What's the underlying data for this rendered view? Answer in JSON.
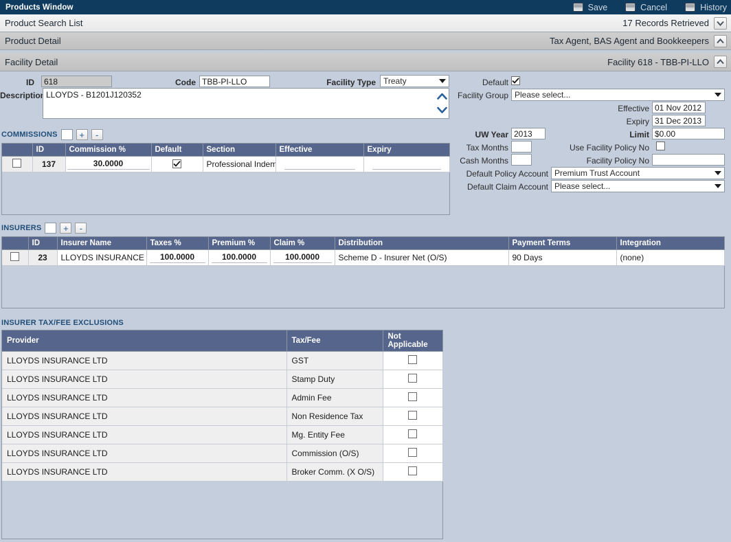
{
  "window": {
    "title": "Products Window"
  },
  "toolbar": {
    "buttons": [
      {
        "label": "Save",
        "icon": "save-icon"
      },
      {
        "label": "Cancel",
        "icon": "cancel-icon"
      },
      {
        "label": "History",
        "icon": "history-icon"
      }
    ]
  },
  "sections": [
    {
      "title": "Product Search List",
      "status": "17 Records Retrieved",
      "chevron": "chevron-down-icon"
    },
    {
      "title": "Product Detail",
      "status": "Tax Agent, BAS Agent and Bookkeepers",
      "chevron": "chevron-up-icon"
    },
    {
      "title": "Facility Detail",
      "status": "Facility 618 - TBB-PI-LLO",
      "chevron": "chevron-up-icon"
    }
  ],
  "facility": {
    "id_label": "ID",
    "id_value": "618",
    "code_label": "Code",
    "code_value": "TBB-PI-LLO",
    "facility_type_label": "Facility Type",
    "facility_type_value": "Treaty",
    "description_label": "Description",
    "description_value": "LLOYDS - B1201J120352",
    "default_label": "Default",
    "default_checked": true,
    "facility_group_label": "Facility Group",
    "facility_group_value": "Please select...",
    "effective_label": "Effective",
    "effective_value": "01 Nov 2012",
    "expiry_label": "Expiry",
    "expiry_value": "31 Dec 2013",
    "uw_year_label": "UW Year",
    "uw_year_value": "2013",
    "limit_label": "Limit",
    "limit_value": "$0.00",
    "tax_months_label": "Tax Months",
    "tax_months_value": "",
    "use_facility_policy_no_label": "Use Facility Policy No",
    "use_facility_policy_no_checked": false,
    "cash_months_label": "Cash Months",
    "cash_months_value": "",
    "facility_policy_no_label": "Facility Policy No",
    "facility_policy_no_value": "",
    "default_policy_account_label": "Default Policy Account",
    "default_policy_account_value": "Premium Trust Account",
    "default_claim_account_label": "Default Claim Account",
    "default_claim_account_value": "Please select..."
  },
  "commissions": {
    "title": "COMMISSIONS",
    "add_label": "+",
    "remove_label": "-",
    "columns": [
      "",
      "ID",
      "Commission %",
      "Default",
      "Section",
      "Effective",
      "Expiry"
    ],
    "rows": [
      {
        "selected": false,
        "id": "137",
        "commission_pct": "30.0000",
        "default": true,
        "section": "Professional Indemni",
        "effective": "",
        "expiry": ""
      }
    ]
  },
  "insurers": {
    "title": "INSURERS",
    "add_label": "+",
    "remove_label": "-",
    "columns": [
      "",
      "ID",
      "Insurer Name",
      "Taxes %",
      "Premium %",
      "Claim %",
      "Distribution",
      "Payment Terms",
      "Integration"
    ],
    "rows": [
      {
        "selected": false,
        "id": "23",
        "insurer_name": "LLOYDS INSURANCE LTD",
        "taxes_pct": "100.0000",
        "premium_pct": "100.0000",
        "claim_pct": "100.0000",
        "distribution": "Scheme D - Insurer Net (O/S)",
        "payment_terms": "90 Days",
        "integration": "(none)"
      }
    ]
  },
  "exclusions": {
    "title": "INSURER TAX/FEE EXCLUSIONS",
    "columns": [
      "Provider",
      "Tax/Fee",
      "Not Applicable"
    ],
    "rows": [
      {
        "provider": "LLOYDS INSURANCE LTD",
        "tax_fee": "GST",
        "not_applicable": false
      },
      {
        "provider": "LLOYDS INSURANCE LTD",
        "tax_fee": "Stamp Duty",
        "not_applicable": false
      },
      {
        "provider": "LLOYDS INSURANCE LTD",
        "tax_fee": "Admin Fee",
        "not_applicable": false
      },
      {
        "provider": "LLOYDS INSURANCE LTD",
        "tax_fee": "Non Residence Tax",
        "not_applicable": false
      },
      {
        "provider": "LLOYDS INSURANCE LTD",
        "tax_fee": "Mg. Entity Fee",
        "not_applicable": false
      },
      {
        "provider": "LLOYDS INSURANCE LTD",
        "tax_fee": "Commission (O/S)",
        "not_applicable": false
      },
      {
        "provider": "LLOYDS INSURANCE LTD",
        "tax_fee": "Broker Comm. (X O/S)",
        "not_applicable": false
      }
    ]
  },
  "colors": {
    "titlebar": "#0f3c5e",
    "grid_header": "#56658c",
    "page_bg": "#c5cedd",
    "section_label": "#1f4e79"
  }
}
